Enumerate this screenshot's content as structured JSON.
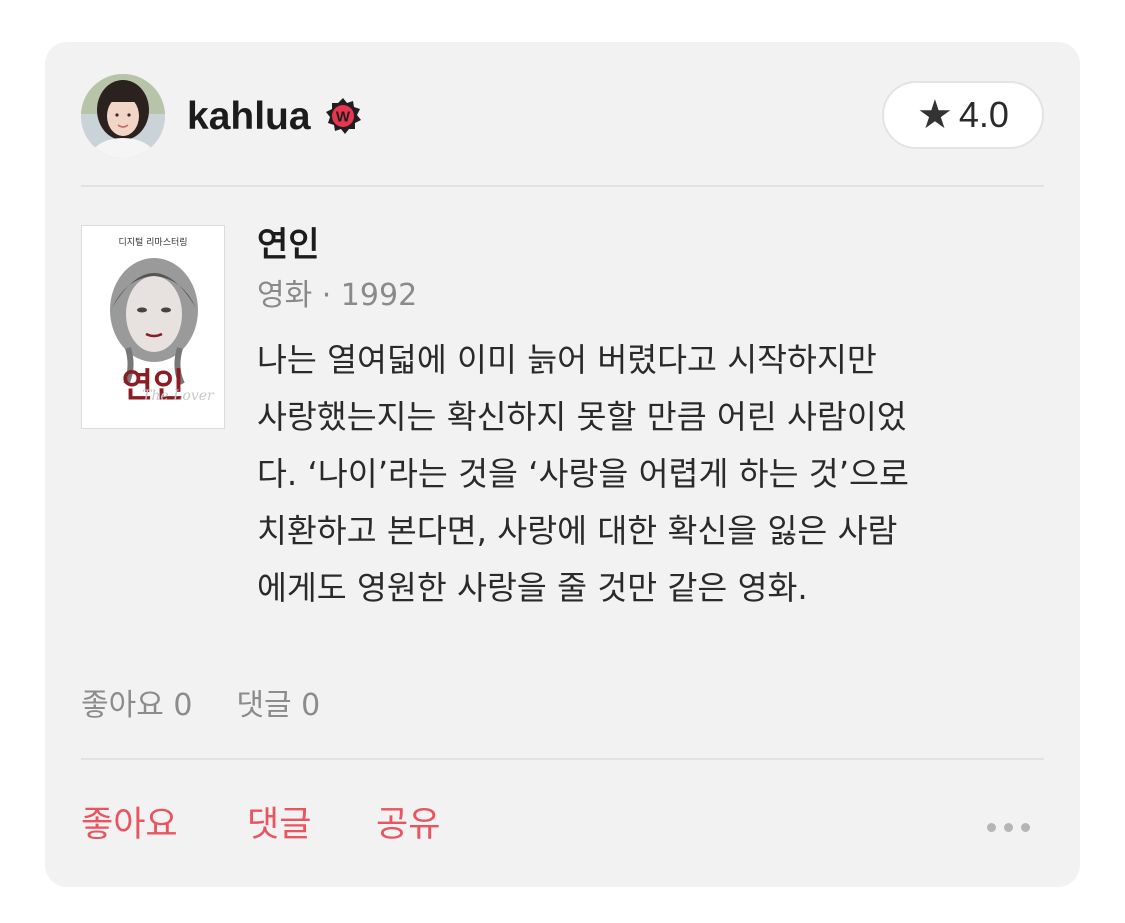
{
  "user": {
    "name": "kahlua",
    "badge_letter": "W"
  },
  "rating": {
    "star": "★",
    "value": "4.0"
  },
  "movie": {
    "poster_top": "디지털 리마스터링",
    "poster_title": "연인",
    "poster_subtitle": "The Lover",
    "title": "연인",
    "meta": "영화 · 1992"
  },
  "review": {
    "lines": [
      "나는 열여덟에 이미 늙어 버렸다고 시작하지만",
      "사랑했는지는 확신하지 못할 만큼 어린 사람이었",
      "다. ‘나이’라는 것을 ‘사랑을 어렵게 하는 것’으로",
      "치환하고 본다면, 사랑에 대한 확신을 잃은 사람",
      "에게도 영원한 사랑을 줄 것만 같은 영화."
    ]
  },
  "stats": {
    "likes": "좋아요 0",
    "comments": "댓글 0"
  },
  "actions": {
    "like": "좋아요",
    "comment": "댓글",
    "share": "공유"
  },
  "colors": {
    "accent": "#e8545f",
    "card_bg": "#f2f2f2",
    "badge": "#e8364f"
  },
  "icons": {
    "rating": "star-icon",
    "badge": "verified-badge-icon",
    "more": "more-dots-icon"
  }
}
